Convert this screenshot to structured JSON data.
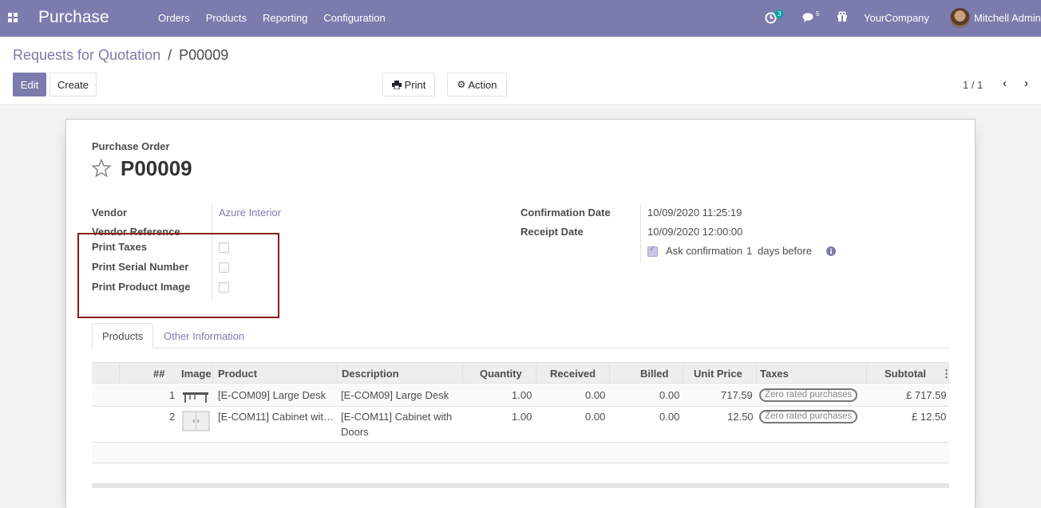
{
  "navbar": {
    "app_name": "Purchase",
    "menu": [
      "Orders",
      "Products",
      "Reporting",
      "Configuration"
    ],
    "activity_count": "3",
    "messages_count": "5",
    "company": "YourCompany",
    "user": "Mitchell Admin"
  },
  "control": {
    "breadcrumb_parent": "Requests for Quotation",
    "breadcrumb_sep": "/",
    "breadcrumb_current": "P00009",
    "edit_label": "Edit",
    "create_label": "Create",
    "print_label": "Print",
    "action_label": "Action",
    "pager": "1 / 1"
  },
  "form": {
    "doc_type": "Purchase Order",
    "name": "P00009",
    "vendor_label": "Vendor",
    "vendor_value": "Azure Interior",
    "vendor_ref_label": "Vendor Reference",
    "print_taxes_label": "Print Taxes",
    "print_serial_label": "Print Serial Number",
    "print_image_label": "Print Product Image",
    "confirmation_date_label": "Confirmation Date",
    "confirmation_date_value": "10/09/2020 11:25:19",
    "receipt_date_label": "Receipt Date",
    "receipt_date_value": "10/09/2020 12:00:00",
    "ask_confirmation_label": "Ask confirmation",
    "ask_confirmation_days": "1",
    "ask_confirmation_suffix": "days before"
  },
  "tabs": [
    "Products",
    "Other Information"
  ],
  "table": {
    "headers": [
      "##",
      "Image",
      "Product",
      "Description",
      "Quantity",
      "Received",
      "Billed",
      "Unit Price",
      "Taxes",
      "Subtotal"
    ],
    "rows": [
      {
        "seq": "1",
        "product": "[E-COM09] Large Desk",
        "description": "[E-COM09] Large Desk",
        "description_line2": "",
        "quantity": "1.00",
        "received": "0.00",
        "billed": "0.00",
        "unit_price": "717.59",
        "tax": "Zero rated purchases",
        "subtotal": "£ 717.59"
      },
      {
        "seq": "2",
        "product": "[E-COM11] Cabinet wit…",
        "description": "[E-COM11] Cabinet with",
        "description_line2": "Doors",
        "quantity": "1.00",
        "received": "0.00",
        "billed": "0.00",
        "unit_price": "12.50",
        "tax": "Zero rated purchases",
        "subtotal": "£ 12.50"
      }
    ]
  },
  "colors": {
    "brand": "#7c7bad",
    "highlight_box": "#8b1a1a"
  }
}
